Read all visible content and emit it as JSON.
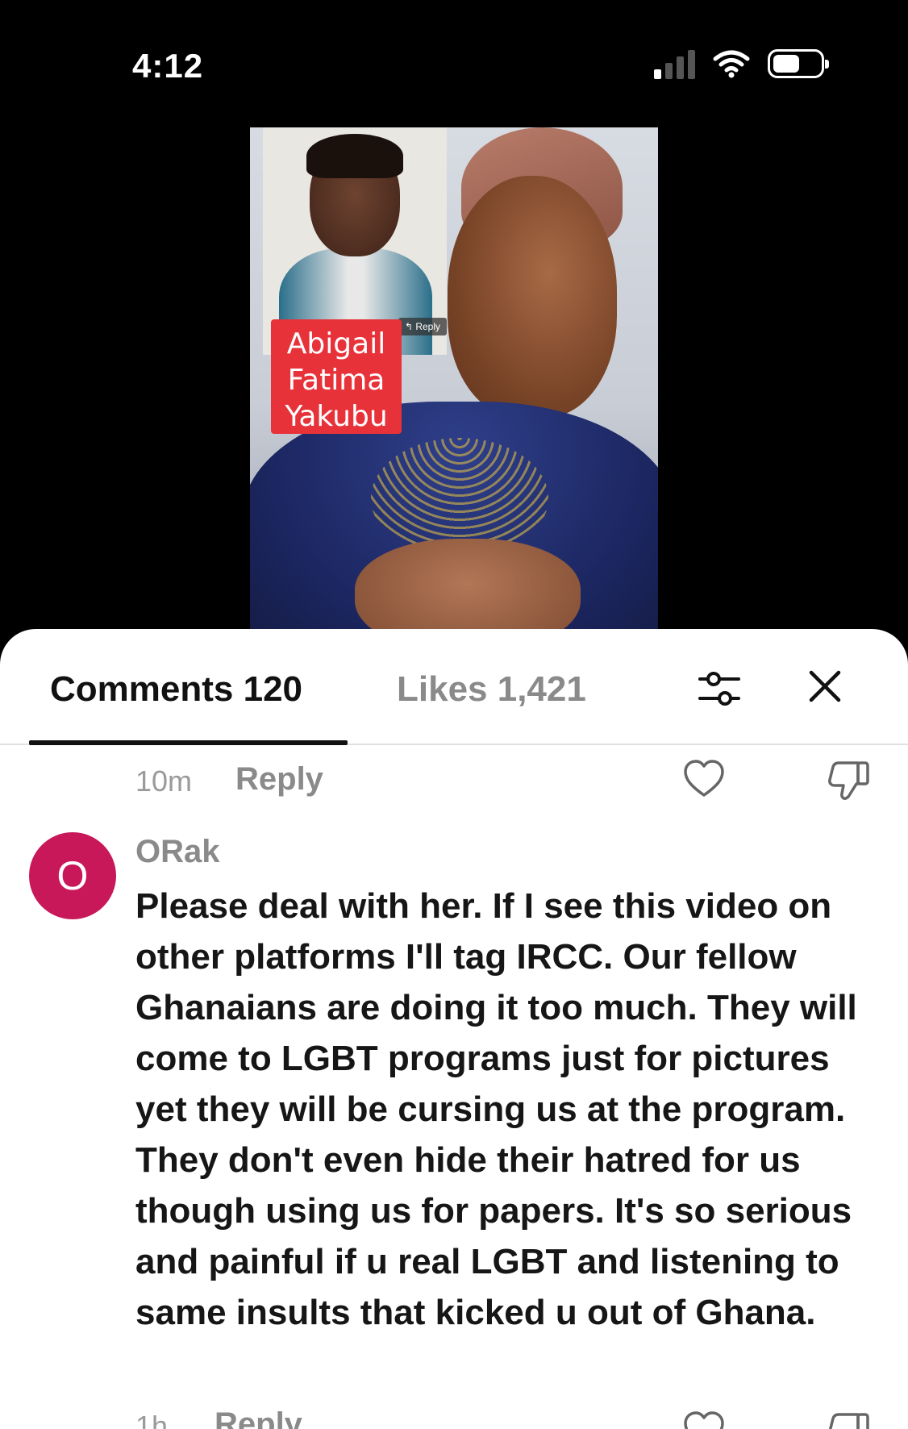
{
  "status_bar": {
    "time": "4:12",
    "icons": [
      "cellular-signal-icon",
      "wifi-icon",
      "battery-icon"
    ]
  },
  "video": {
    "name_label_lines": [
      "Abigail",
      "Fatima",
      "Yakubu"
    ],
    "reply_tag": "Reply",
    "label_color": "#e8323a"
  },
  "sheet": {
    "tabs": [
      {
        "label": "Comments 120",
        "active": true
      },
      {
        "label": "Likes 1,421",
        "active": false
      }
    ],
    "icons": [
      "filter-icon",
      "close-icon"
    ]
  },
  "previous_comment_meta": {
    "time": "10m",
    "reply_label": "Reply"
  },
  "comment": {
    "avatar_letter": "O",
    "avatar_color": "#c8185a",
    "username": "ORak",
    "text": "Please deal with her. If I see this video on other platforms I'll tag IRCC. Our fellow Ghanaians are doing it too much. They will come to LGBT programs just for pictures yet they will be cursing us at the program. They don't even hide their hatred for us though using us for papers. It's so serious and painful if u real LGBT and listening to same insults that kicked u out of Ghana.",
    "time": "1h",
    "reply_label": "Reply"
  }
}
